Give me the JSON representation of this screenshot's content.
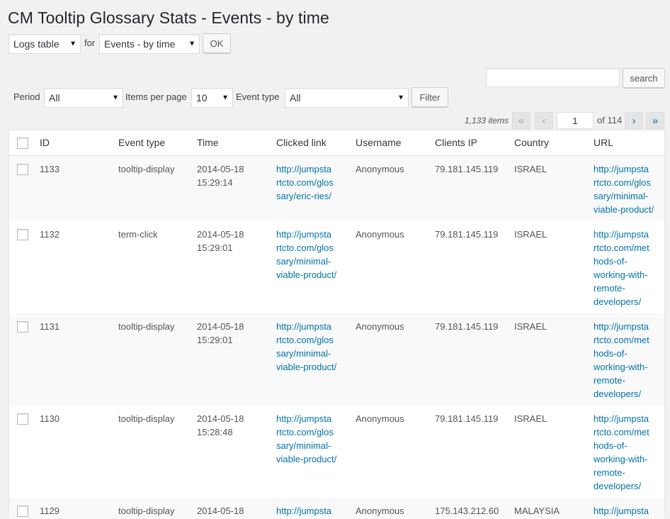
{
  "page": {
    "title": "CM Tooltip Glossary Stats - Events - by time"
  },
  "top_controls": {
    "view_select": "Logs table",
    "for_label": "for",
    "report_select": "Events - by time",
    "ok_label": "OK"
  },
  "search": {
    "value": "",
    "button_label": "search"
  },
  "filters": {
    "period_label": "Period",
    "period_value": "All",
    "items_per_page_label": "Items per page",
    "items_per_page_value": "10",
    "event_type_label": "Event type",
    "event_type_value": "All",
    "filter_button": "Filter"
  },
  "pagination": {
    "count": "1,133 items",
    "first": "«",
    "prev": "‹",
    "current_page": "1",
    "of_total": "of 114",
    "next": "›",
    "last": "»"
  },
  "table": {
    "columns": [
      "ID",
      "Event type",
      "Time",
      "Clicked link",
      "Username",
      "Clients IP",
      "Country",
      "URL"
    ],
    "rows": [
      {
        "id": "1133",
        "event_type": "tooltip-display",
        "time_date": "2014-05-18",
        "time_clock": "15:29:14",
        "clicked_link": [
          "http://jumpsta",
          "rtcto.com/glos",
          "sary/eric-ries/"
        ],
        "username": "Anonymous",
        "ip": "79.181.145.119",
        "country": "ISRAEL",
        "url": [
          "http://jumpsta",
          "rtcto.com/glos",
          "sary/minimal-",
          "viable-product/"
        ]
      },
      {
        "id": "1132",
        "event_type": "term-click",
        "time_date": "2014-05-18",
        "time_clock": "15:29:01",
        "clicked_link": [
          "http://jumpsta",
          "rtcto.com/glos",
          "sary/minimal-",
          "viable-product/"
        ],
        "username": "Anonymous",
        "ip": "79.181.145.119",
        "country": "ISRAEL",
        "url": [
          "http://jumpsta",
          "rtcto.com/met",
          "hods-of-",
          "working-with-",
          "remote-",
          "developers/"
        ]
      },
      {
        "id": "1131",
        "event_type": "tooltip-display",
        "time_date": "2014-05-18",
        "time_clock": "15:29:01",
        "clicked_link": [
          "http://jumpsta",
          "rtcto.com/glos",
          "sary/minimal-",
          "viable-product/"
        ],
        "username": "Anonymous",
        "ip": "79.181.145.119",
        "country": "ISRAEL",
        "url": [
          "http://jumpsta",
          "rtcto.com/met",
          "hods-of-",
          "working-with-",
          "remote-",
          "developers/"
        ]
      },
      {
        "id": "1130",
        "event_type": "tooltip-display",
        "time_date": "2014-05-18",
        "time_clock": "15:28:48",
        "clicked_link": [
          "http://jumpsta",
          "rtcto.com/glos",
          "sary/minimal-",
          "viable-product/"
        ],
        "username": "Anonymous",
        "ip": "79.181.145.119",
        "country": "ISRAEL",
        "url": [
          "http://jumpsta",
          "rtcto.com/met",
          "hods-of-",
          "working-with-",
          "remote-",
          "developers/"
        ]
      },
      {
        "id": "1129",
        "event_type": "tooltip-display",
        "time_date": "2014-05-18",
        "time_clock": "",
        "clicked_link": [
          "http://jumpsta"
        ],
        "username": "Anonymous",
        "ip": "175.143.212.60",
        "country": "MALAYSIA",
        "url": [
          "http://jumpsta"
        ]
      }
    ]
  },
  "colors": {
    "link": "#0073aa",
    "background": "#f1f1f1",
    "alt_row": "#f9f9f9"
  }
}
